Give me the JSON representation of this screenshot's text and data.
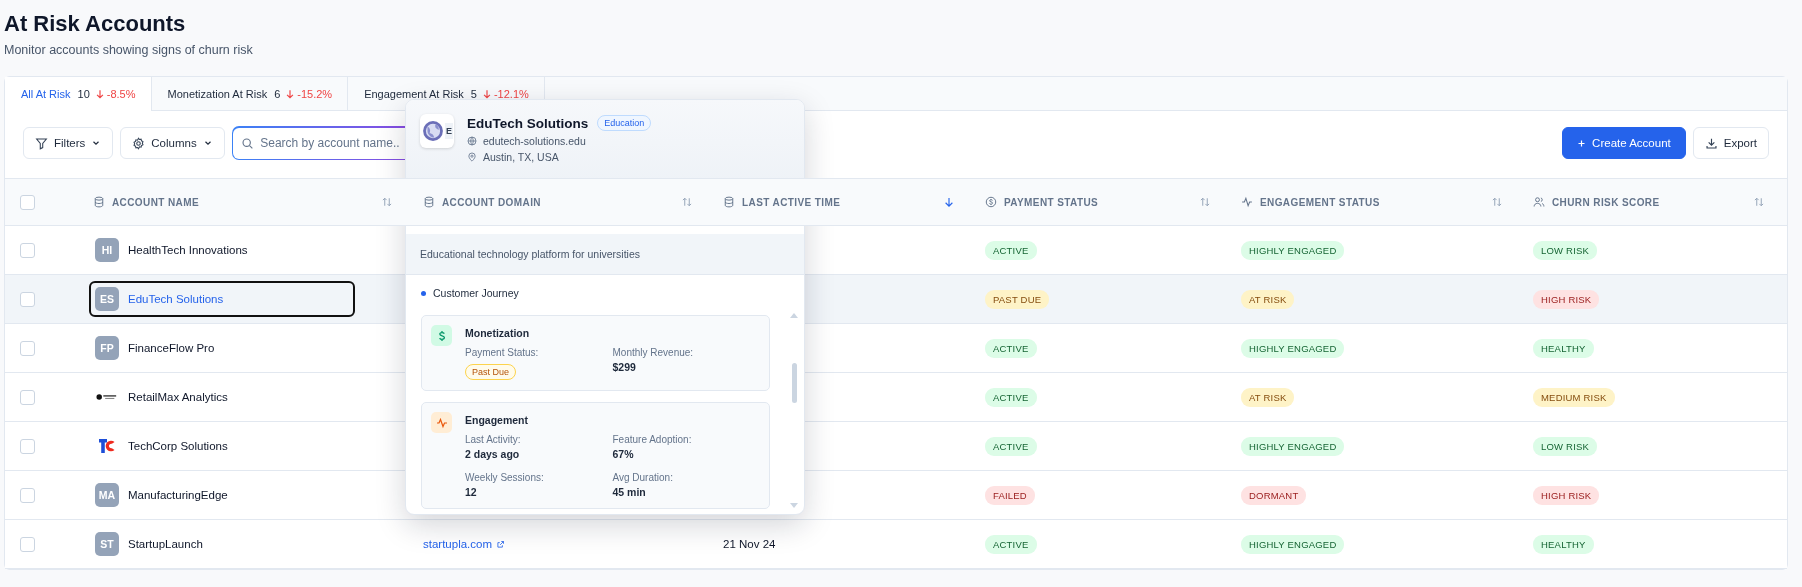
{
  "page": {
    "title": "At Risk Accounts",
    "subtitle": "Monitor accounts showing signs of churn risk"
  },
  "tabs": [
    {
      "label": "All At Risk",
      "count": "10",
      "change": "-8.5%",
      "selected": true
    },
    {
      "label": "Monetization At Risk",
      "count": "6",
      "change": "-15.2%",
      "selected": false
    },
    {
      "label": "Engagement At Risk",
      "count": "5",
      "change": "-12.1%",
      "selected": false
    }
  ],
  "toolbar": {
    "filters": "Filters",
    "columns": "Columns",
    "search_placeholder": "Search by account name..",
    "create": "Create Account",
    "export": "Export"
  },
  "table": {
    "select_all_checked": false,
    "columns": [
      {
        "label": "ACCOUNT NAME",
        "sorted": false
      },
      {
        "label": "ACCOUNT DOMAIN",
        "sorted": false
      },
      {
        "label": "LAST ACTIVE TIME",
        "sorted": true
      },
      {
        "label": "PAYMENT STATUS",
        "sorted": false
      },
      {
        "label": "ENGAGEMENT STATUS",
        "sorted": false
      },
      {
        "label": "CHURN RISK SCORE",
        "sorted": false
      }
    ],
    "rows": [
      {
        "checked": false,
        "selected": false,
        "focused": false,
        "avatar": {
          "kind": "initials",
          "text": "HI"
        },
        "name": "HealthTech Innovations",
        "payment": {
          "text": "ACTIVE",
          "kind": "good"
        },
        "engagement": {
          "text": "HIGHLY ENGAGED",
          "kind": "good"
        },
        "risk": {
          "text": "LOW RISK",
          "kind": "good"
        }
      },
      {
        "checked": false,
        "selected": true,
        "focused": true,
        "avatar": {
          "kind": "initials",
          "text": "ES"
        },
        "name": "EduTech Solutions",
        "payment": {
          "text": "PAST DUE",
          "kind": "warn"
        },
        "engagement": {
          "text": "AT RISK",
          "kind": "warn"
        },
        "risk": {
          "text": "HIGH RISK",
          "kind": "bad"
        }
      },
      {
        "checked": false,
        "selected": false,
        "focused": false,
        "avatar": {
          "kind": "initials",
          "text": "FP"
        },
        "name": "FinanceFlow Pro",
        "payment": {
          "text": "ACTIVE",
          "kind": "good"
        },
        "engagement": {
          "text": "HIGHLY ENGAGED",
          "kind": "good"
        },
        "risk": {
          "text": "HEALTHY",
          "kind": "good"
        }
      },
      {
        "checked": false,
        "selected": false,
        "focused": false,
        "avatar": {
          "kind": "dark-logo"
        },
        "name": "RetailMax Analytics",
        "payment": {
          "text": "ACTIVE",
          "kind": "good"
        },
        "engagement": {
          "text": "AT RISK",
          "kind": "warn"
        },
        "risk": {
          "text": "MEDIUM RISK",
          "kind": "warn"
        }
      },
      {
        "checked": false,
        "selected": false,
        "focused": false,
        "avatar": {
          "kind": "color-logo"
        },
        "name": "TechCorp Solutions",
        "payment": {
          "text": "ACTIVE",
          "kind": "good"
        },
        "engagement": {
          "text": "HIGHLY ENGAGED",
          "kind": "good"
        },
        "risk": {
          "text": "LOW RISK",
          "kind": "good"
        }
      },
      {
        "checked": false,
        "selected": false,
        "focused": false,
        "avatar": {
          "kind": "initials",
          "text": "MA"
        },
        "name": "ManufacturingEdge",
        "payment": {
          "text": "FAILED",
          "kind": "bad"
        },
        "engagement": {
          "text": "DORMANT",
          "kind": "bad"
        },
        "risk": {
          "text": "HIGH RISK",
          "kind": "bad"
        }
      },
      {
        "checked": false,
        "selected": false,
        "focused": false,
        "avatar": {
          "kind": "initials",
          "text": "ST"
        },
        "name": "StartupLaunch",
        "domain": "startupla.com",
        "last_active": "21 Nov 24",
        "payment": {
          "text": "ACTIVE",
          "kind": "good"
        },
        "engagement": {
          "text": "HIGHLY ENGAGED",
          "kind": "good"
        },
        "risk": {
          "text": "HEALTHY",
          "kind": "good"
        }
      }
    ]
  },
  "popover": {
    "avatar_letter": "E",
    "title": "EduTech Solutions",
    "tag": "Education",
    "website": "edutech-solutions.edu",
    "location": "Austin, TX, USA",
    "description": "Educational technology platform for universities",
    "section_title": "Customer Journey",
    "cards": [
      {
        "kind": "monetization",
        "title": "Monetization",
        "fields": [
          {
            "label": "Payment Status:",
            "value": "Past Due",
            "kind": "badge"
          },
          {
            "label": "Monthly Revenue:",
            "value": "$299",
            "kind": "text"
          }
        ]
      },
      {
        "kind": "engagement",
        "title": "Engagement",
        "fields": [
          {
            "label": "Last Activity:",
            "value": "2 days ago",
            "kind": "text"
          },
          {
            "label": "Feature Adoption:",
            "value": "67%",
            "kind": "text"
          },
          {
            "label": "Weekly Sessions:",
            "value": "12",
            "kind": "text"
          },
          {
            "label": "Avg Duration:",
            "value": "45 min",
            "kind": "text"
          }
        ]
      }
    ]
  }
}
